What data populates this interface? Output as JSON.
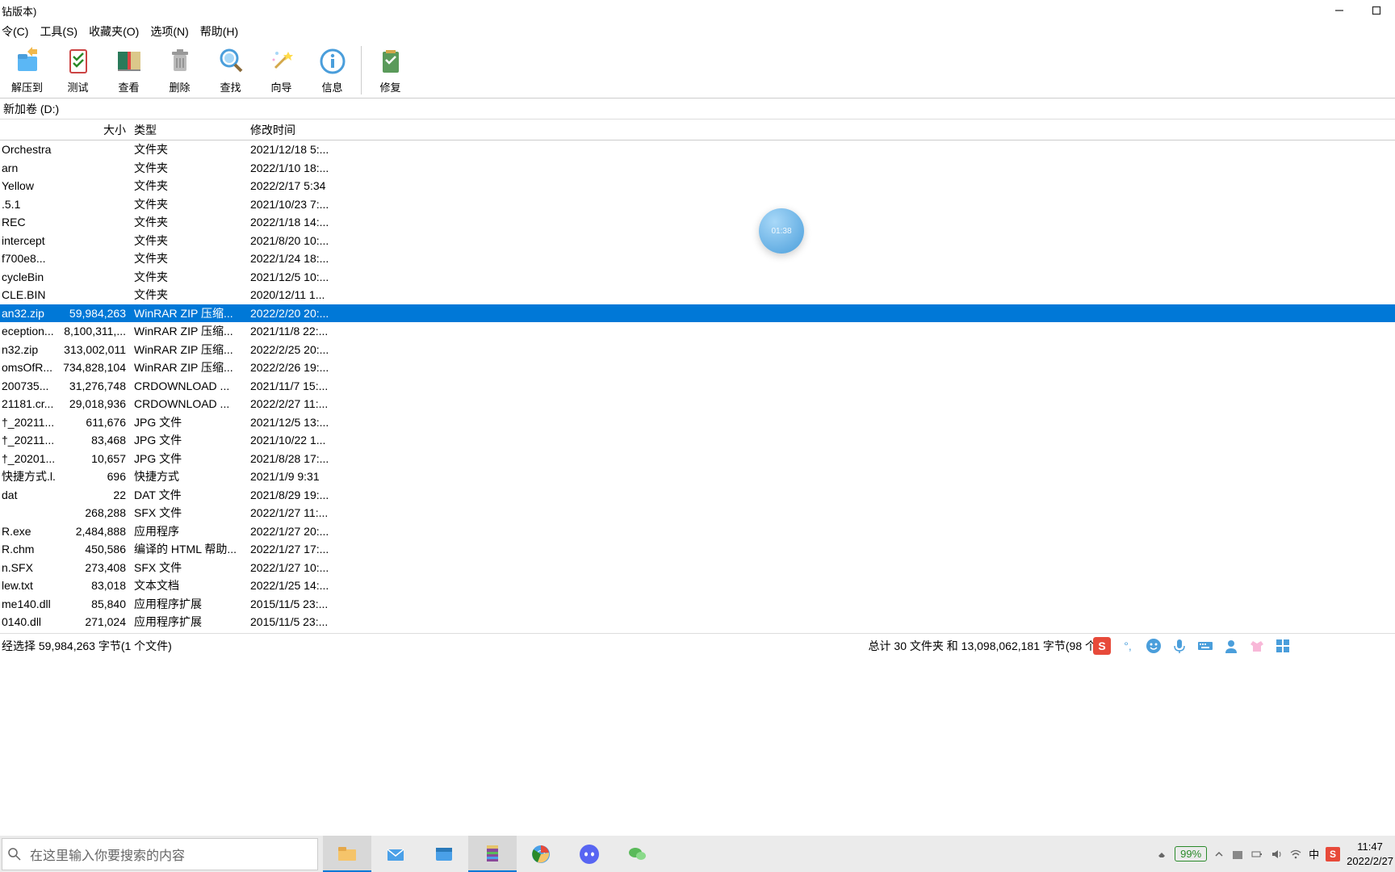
{
  "window": {
    "title": "钻版本)"
  },
  "menu": [
    "令(C)",
    "工具(S)",
    "收藏夹(O)",
    "选项(N)",
    "帮助(H)"
  ],
  "toolbar": [
    {
      "label": "解压到",
      "icon": "extract"
    },
    {
      "label": "测试",
      "icon": "test"
    },
    {
      "label": "查看",
      "icon": "view"
    },
    {
      "label": "删除",
      "icon": "delete"
    },
    {
      "label": "查找",
      "icon": "find"
    },
    {
      "label": "向导",
      "icon": "wizard"
    },
    {
      "label": "信息",
      "icon": "info"
    },
    {
      "label": "修复",
      "icon": "repair"
    }
  ],
  "address": "新加卷 (D:)",
  "columns": {
    "size": "大小",
    "type": "类型",
    "date": "修改时间"
  },
  "files": [
    {
      "name": "Orchestra",
      "size": "",
      "type": "文件夹",
      "date": "2021/12/18 5:..."
    },
    {
      "name": "arn",
      "size": "",
      "type": "文件夹",
      "date": "2022/1/10 18:..."
    },
    {
      "name": "Yellow",
      "size": "",
      "type": "文件夹",
      "date": "2022/2/17 5:34"
    },
    {
      "name": ".5.1",
      "size": "",
      "type": "文件夹",
      "date": "2021/10/23 7:..."
    },
    {
      "name": "REC",
      "size": "",
      "type": "文件夹",
      "date": "2022/1/18 14:..."
    },
    {
      "name": "intercept",
      "size": "",
      "type": "文件夹",
      "date": "2021/8/20 10:..."
    },
    {
      "name": "f700e8...",
      "size": "",
      "type": "文件夹",
      "date": "2022/1/24 18:..."
    },
    {
      "name": "cycleBin",
      "size": "",
      "type": "文件夹",
      "date": "2021/12/5 10:..."
    },
    {
      "name": "CLE.BIN",
      "size": "",
      "type": "文件夹",
      "date": "2020/12/11 1..."
    },
    {
      "name": "an32.zip",
      "size": "59,984,263",
      "type": "WinRAR ZIP 压缩...",
      "date": "2022/2/20 20:...",
      "selected": true
    },
    {
      "name": "eception...",
      "size": "8,100,311,...",
      "type": "WinRAR ZIP 压缩...",
      "date": "2021/11/8 22:..."
    },
    {
      "name": "n32.zip",
      "size": "313,002,011",
      "type": "WinRAR ZIP 压缩...",
      "date": "2022/2/25 20:..."
    },
    {
      "name": "omsOfR...",
      "size": "734,828,104",
      "type": "WinRAR ZIP 压缩...",
      "date": "2022/2/26 19:..."
    },
    {
      "name": "200735...",
      "size": "31,276,748",
      "type": "CRDOWNLOAD ...",
      "date": "2021/11/7 15:..."
    },
    {
      "name": "21181.cr...",
      "size": "29,018,936",
      "type": "CRDOWNLOAD ...",
      "date": "2022/2/27 11:..."
    },
    {
      "name": "†_20211...",
      "size": "611,676",
      "type": "JPG 文件",
      "date": "2021/12/5 13:..."
    },
    {
      "name": "†_20211...",
      "size": "83,468",
      "type": "JPG 文件",
      "date": "2021/10/22 1..."
    },
    {
      "name": "†_20201...",
      "size": "10,657",
      "type": "JPG 文件",
      "date": "2021/8/28 17:..."
    },
    {
      "name": "快捷方式.l...",
      "size": "696",
      "type": "快捷方式",
      "date": "2021/1/9 9:31"
    },
    {
      "name": "dat",
      "size": "22",
      "type": "DAT 文件",
      "date": "2021/8/29 19:..."
    },
    {
      "name": "",
      "size": "268,288",
      "type": "SFX 文件",
      "date": "2022/1/27 11:..."
    },
    {
      "name": "R.exe",
      "size": "2,484,888",
      "type": "应用程序",
      "date": "2022/1/27 20:..."
    },
    {
      "name": "R.chm",
      "size": "450,586",
      "type": "编译的 HTML 帮助...",
      "date": "2022/1/27 17:..."
    },
    {
      "name": "n.SFX",
      "size": "273,408",
      "type": "SFX 文件",
      "date": "2022/1/27 10:..."
    },
    {
      "name": "lew.txt",
      "size": "83,018",
      "type": "文本文档",
      "date": "2022/1/25 14:..."
    },
    {
      "name": "me140.dll",
      "size": "85,840",
      "type": "应用程序扩展",
      "date": "2015/11/5 23:..."
    },
    {
      "name": "0140.dll",
      "size": "271,024",
      "type": "应用程序扩展",
      "date": "2015/11/5 23:..."
    }
  ],
  "status": {
    "left": "经选择 59,984,263 字节(1 个文件)",
    "right": "总计 30 文件夹 和 13,098,062,181 字节(98 个"
  },
  "widget_time": "01:38",
  "search_placeholder": "在这里输入你要搜索的内容",
  "battery": "99%",
  "clock": {
    "time": "11:47",
    "date": "2022/2/27"
  }
}
